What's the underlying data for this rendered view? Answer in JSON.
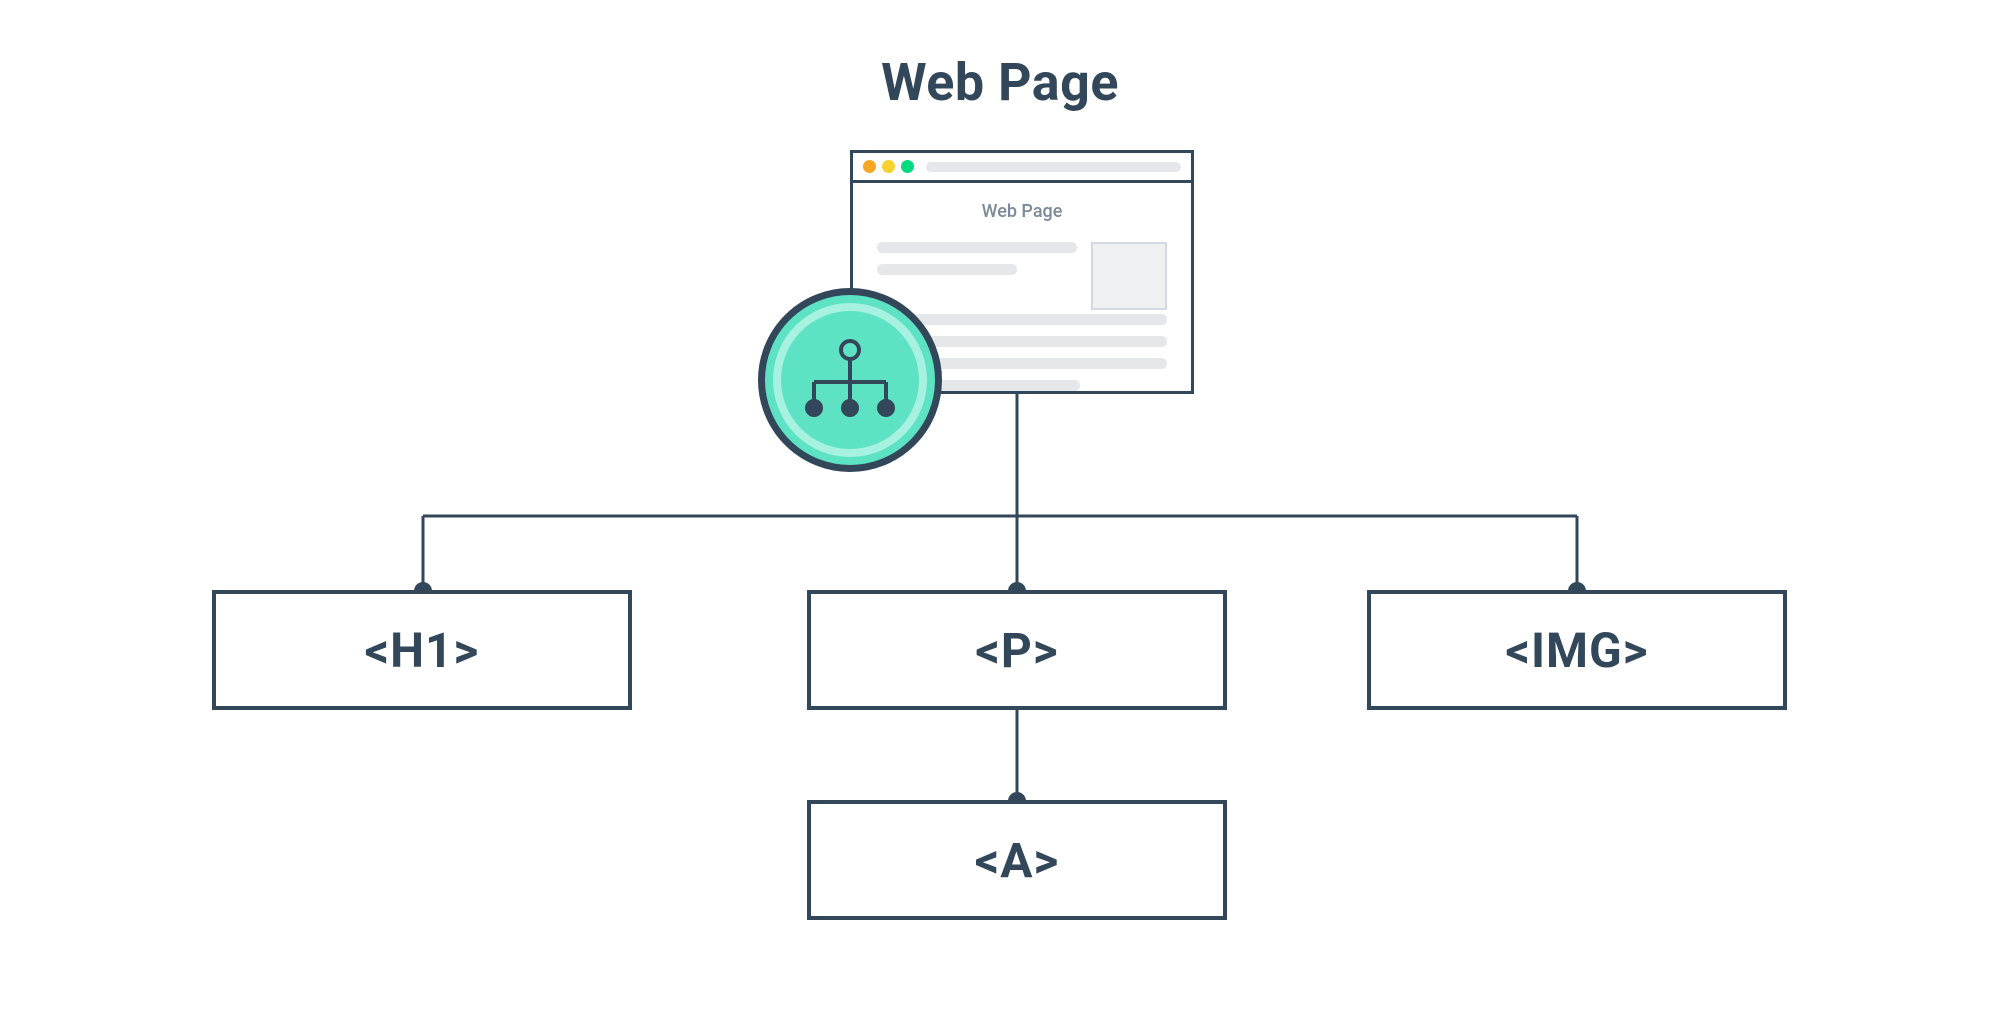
{
  "title": "Web Page",
  "browser": {
    "page_label": "Web Page"
  },
  "nodes": {
    "h1": "<H1>",
    "p": "<P>",
    "img": "<IMG>",
    "a": "<A>"
  },
  "colors": {
    "dark": "#33475b",
    "teal": "#5de2c4",
    "teal_light": "#a6f1df",
    "gray_line": "#e5e8eb",
    "dot_orange": "#f5a623",
    "dot_yellow": "#f8d12f",
    "dot_green": "#00d97e"
  }
}
